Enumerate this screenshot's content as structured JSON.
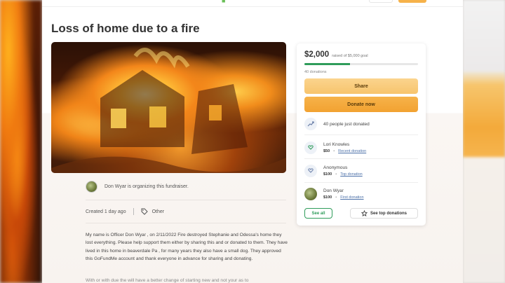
{
  "page": {
    "title": "Loss of home due to a fire"
  },
  "organizer": {
    "text": "Don Wyar is organizing this fundraiser."
  },
  "meta": {
    "created": "Created 1 day ago",
    "category": "Other"
  },
  "story": {
    "paragraph": "My name is Officer Don Wyar , on 2/11/2022 Fire destroyed Stephanie and Odessa's home they lost everything. Please help support them either by sharing this and or donated to them. They have lived in this home in beaverdale Pa , for many years they also have a small dog. They approved this GoFundMe account and thank everyone in advance for sharing and donating.",
    "cutoff": "With or with due the will have a better change of starting new and not your as to"
  },
  "donation_card": {
    "raised": "$2,000",
    "goal": "raised of $5,000 goal",
    "progress_fraction": 0.4,
    "donations_count": "40 donations",
    "share_label": "Share",
    "donate_label": "Donate now",
    "recent_summary": "40 people just donated",
    "donors": [
      {
        "name": "Lori Knowles",
        "amount": "$50",
        "tag": "Recent donation",
        "icon": "heart-hand-icon"
      },
      {
        "name": "Anonymous",
        "amount": "$100",
        "tag": "Top donation",
        "icon": "heart-hand-icon"
      },
      {
        "name": "Don Wyar",
        "amount": "$100",
        "tag": "First donation",
        "icon": "avatar"
      }
    ],
    "see_all_label": "See all",
    "see_top_label": "See top donations"
  },
  "colors": {
    "accent_green": "#2f9c5a",
    "button_orange": "#f2a231",
    "share_yellow": "#f7c46d"
  }
}
